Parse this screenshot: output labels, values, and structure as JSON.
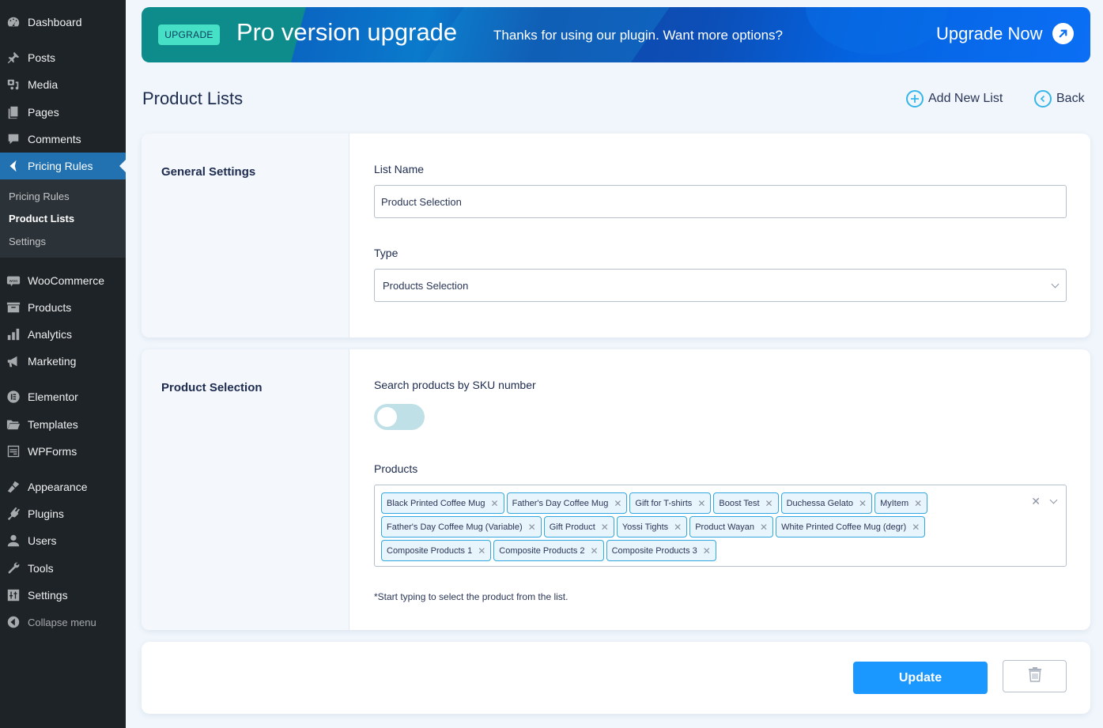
{
  "sidebar": {
    "items": [
      {
        "label": "Dashboard",
        "icon": "dashboard-icon"
      },
      {
        "label": "Posts",
        "icon": "pin-icon"
      },
      {
        "label": "Media",
        "icon": "media-icon"
      },
      {
        "label": "Pages",
        "icon": "pages-icon"
      },
      {
        "label": "Comments",
        "icon": "comment-icon"
      },
      {
        "label": "Pricing Rules",
        "icon": "chevron-left-icon",
        "active": true
      },
      {
        "label": "WooCommerce",
        "icon": "woo-icon"
      },
      {
        "label": "Products",
        "icon": "archive-icon"
      },
      {
        "label": "Analytics",
        "icon": "bar-chart-icon"
      },
      {
        "label": "Marketing",
        "icon": "megaphone-icon"
      },
      {
        "label": "Elementor",
        "icon": "elementor-icon"
      },
      {
        "label": "Templates",
        "icon": "folder-icon"
      },
      {
        "label": "WPForms",
        "icon": "form-icon"
      },
      {
        "label": "Appearance",
        "icon": "brush-icon"
      },
      {
        "label": "Plugins",
        "icon": "plug-icon"
      },
      {
        "label": "Users",
        "icon": "user-icon"
      },
      {
        "label": "Tools",
        "icon": "wrench-icon"
      },
      {
        "label": "Settings",
        "icon": "sliders-icon"
      },
      {
        "label": "Collapse menu",
        "icon": "collapse-icon"
      }
    ],
    "submenu": [
      {
        "label": "Pricing Rules"
      },
      {
        "label": "Product Lists",
        "current": true
      },
      {
        "label": "Settings"
      }
    ]
  },
  "banner": {
    "badge": "UPGRADE",
    "title": "Pro version upgrade",
    "subtitle": "Thanks for using our plugin. Want more options?",
    "cta": "Upgrade Now"
  },
  "header": {
    "title": "Product Lists",
    "add_new": "Add New List",
    "back": "Back"
  },
  "general": {
    "section_title": "General Settings",
    "list_name_label": "List Name",
    "list_name_value": "Product Selection",
    "type_label": "Type",
    "type_value": "Products Selection"
  },
  "selection": {
    "section_title": "Product Selection",
    "sku_label": "Search products by SKU number",
    "sku_toggle_on": false,
    "products_label": "Products",
    "products": [
      "Black Printed Coffee Mug",
      "Father's Day Coffee Mug",
      "Gift for T-shirts",
      "Boost Test",
      "Duchessa Gelato",
      "MyItem",
      "Father's Day Coffee Mug (Variable)",
      "Gift Product",
      "Yossi Tights",
      "Product Wayan",
      "White Printed Coffee Mug (degr)",
      "Composite Products 1",
      "Composite Products 2",
      "Composite Products 3"
    ],
    "hint": "*Start typing to select the product from the list."
  },
  "actions": {
    "update": "Update"
  },
  "colors": {
    "accent": "#1a98ff",
    "tag_border": "#33a8e0",
    "wp_active": "#2271b1"
  }
}
